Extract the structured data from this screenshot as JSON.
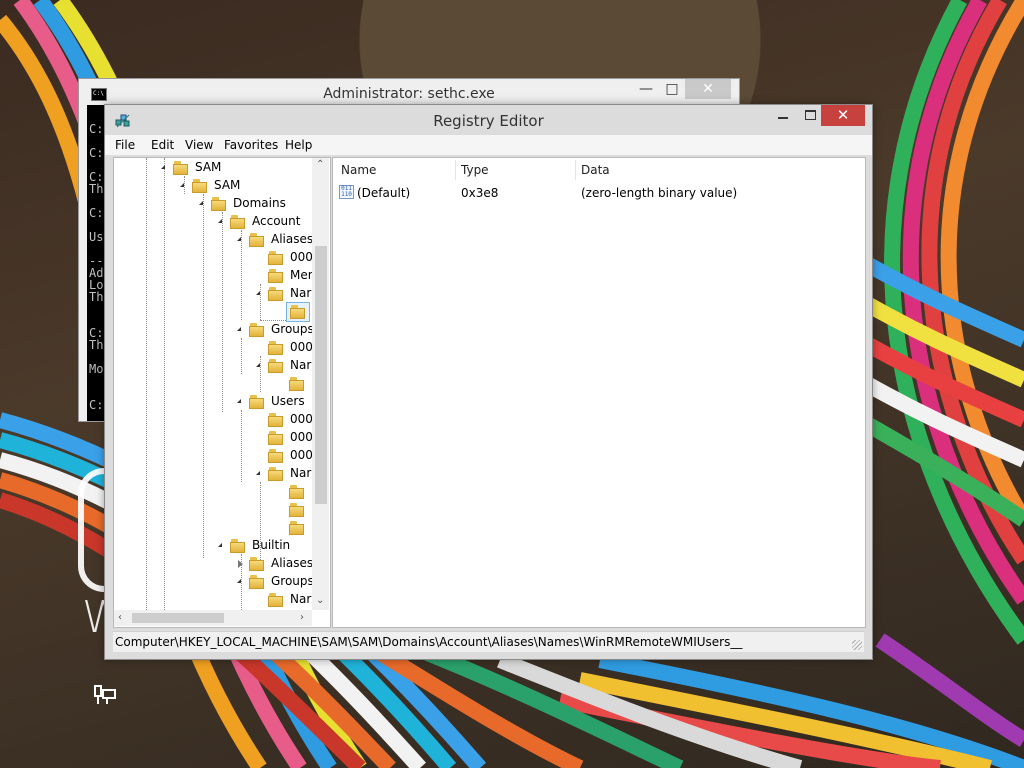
{
  "cmd_window": {
    "title": "Administrator: sethc.exe",
    "lines": [
      "C:",
      "C:",
      "C:",
      "Th",
      "C:",
      "Us",
      "--",
      "Ad",
      "Lo",
      "Th",
      "C:",
      "Th",
      "Mo",
      "C:"
    ]
  },
  "registry_editor": {
    "title": "Registry Editor",
    "menu": [
      "File",
      "Edit",
      "View",
      "Favorites",
      "Help"
    ],
    "tree": [
      {
        "label": "SAM"
      },
      {
        "label": "SAM"
      },
      {
        "label": "Domains"
      },
      {
        "label": "Account"
      },
      {
        "label": "Aliases"
      },
      {
        "label": "000"
      },
      {
        "label": "Mer"
      },
      {
        "label": "Nar"
      },
      {
        "label": ""
      },
      {
        "label": "Groups"
      },
      {
        "label": "000"
      },
      {
        "label": "Nar"
      },
      {
        "label": ""
      },
      {
        "label": "Users"
      },
      {
        "label": "000"
      },
      {
        "label": "000"
      },
      {
        "label": "000"
      },
      {
        "label": "Nar"
      },
      {
        "label": ""
      },
      {
        "label": ""
      },
      {
        "label": ""
      },
      {
        "label": "Builtin"
      },
      {
        "label": "Aliases"
      },
      {
        "label": "Groups"
      },
      {
        "label": "Nar"
      }
    ],
    "columns": [
      "Name",
      "Type",
      "Data"
    ],
    "values": [
      {
        "name": "(Default)",
        "type": "0x3e8",
        "data": "(zero-length binary value)"
      }
    ],
    "value_icon_text": "011\n110",
    "status_path": "Computer\\HKEY_LOCAL_MACHINE\\SAM\\SAM\\Domains\\Account\\Aliases\\Names\\WinRMRemoteWMIUsers__"
  },
  "desktop": {
    "lock_letter": "W"
  }
}
